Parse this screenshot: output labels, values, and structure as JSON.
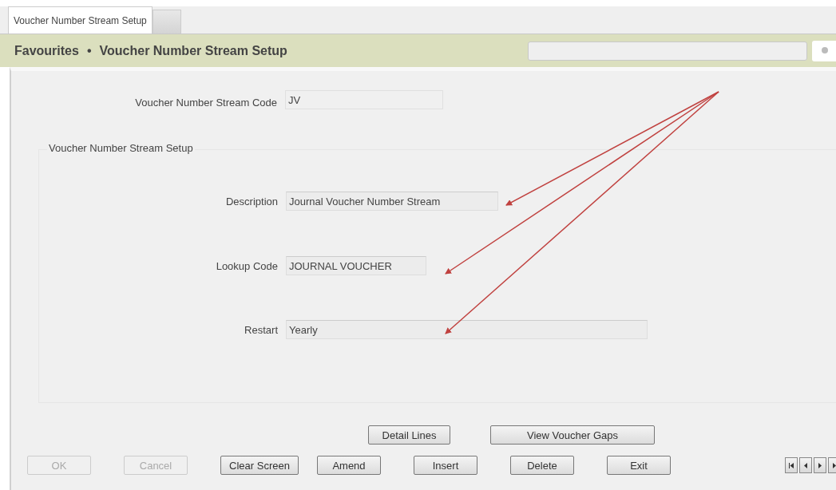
{
  "tabs": [
    {
      "label": "Voucher Number Stream Setup",
      "selected": true
    },
    {
      "selected": false
    }
  ],
  "breadcrumb": {
    "items": [
      "Favourites",
      "Voucher Number Stream Setup"
    ],
    "separator": "•"
  },
  "top_field": {
    "label": "Voucher Number Stream Code",
    "value": "JV"
  },
  "group": {
    "title": "Voucher Number Stream Setup",
    "fields": [
      {
        "label": "Description",
        "value": "Journal Voucher Number Stream"
      },
      {
        "label": "Lookup Code",
        "value": "JOURNAL VOUCHER"
      },
      {
        "label": "Restart",
        "value": "Yearly"
      }
    ]
  },
  "action_buttons": [
    "Detail Lines",
    "View Voucher Gaps"
  ],
  "buttons": [
    {
      "label": "OK",
      "disabled": true
    },
    {
      "label": "Cancel",
      "disabled": true
    },
    {
      "label": "Clear Screen",
      "disabled": false
    },
    {
      "label": "Amend",
      "disabled": false
    },
    {
      "label": "Insert",
      "disabled": false
    },
    {
      "label": "Delete",
      "disabled": false
    },
    {
      "label": "Exit",
      "disabled": false
    }
  ]
}
